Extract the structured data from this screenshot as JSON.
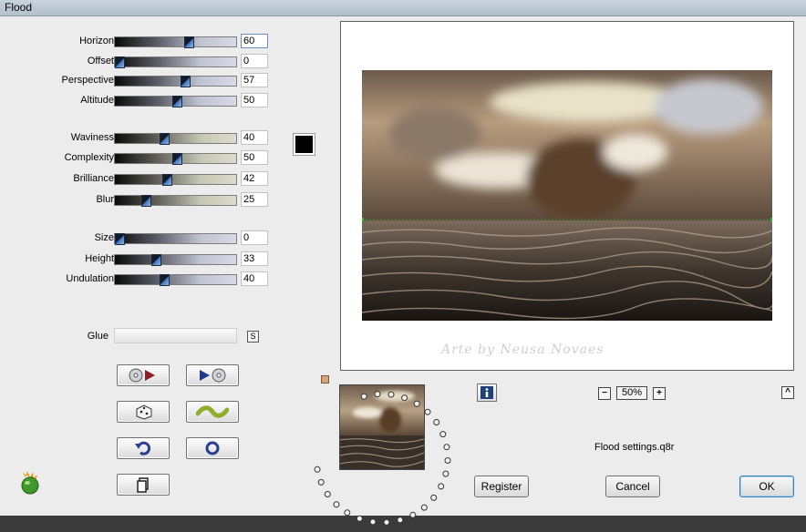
{
  "window": {
    "title": "Flood"
  },
  "sliders": [
    {
      "label": "Horizon",
      "value": "60",
      "fraction": 0.6,
      "track": "blue",
      "focused": true
    },
    {
      "label": "Offset",
      "value": "0",
      "fraction": 0.03,
      "track": "blue"
    },
    {
      "label": "Perspective",
      "value": "57",
      "fraction": 0.57,
      "track": "blue"
    },
    {
      "label": "Altitude",
      "value": "50",
      "fraction": 0.5,
      "track": "blue"
    },
    {
      "label": "Waviness",
      "value": "40",
      "fraction": 0.4,
      "track": "sand"
    },
    {
      "label": "Complexity",
      "value": "50",
      "fraction": 0.5,
      "track": "sand"
    },
    {
      "label": "Brilliance",
      "value": "42",
      "fraction": 0.42,
      "track": "sand"
    },
    {
      "label": "Blur",
      "value": "25",
      "fraction": 0.25,
      "track": "sand"
    },
    {
      "label": "Size",
      "value": "0",
      "fraction": 0.03,
      "track": "blue"
    },
    {
      "label": "Height",
      "value": "33",
      "fraction": 0.33,
      "track": "blue"
    },
    {
      "label": "Undulation",
      "value": "40",
      "fraction": 0.4,
      "track": "blue"
    }
  ],
  "glue": {
    "label": "Glue",
    "mode": "S"
  },
  "color": {
    "swatch": "#000000",
    "accent_blue": "#3f73b8",
    "ok_border": "#3c7fb1",
    "horizon_marker": "#21c621"
  },
  "preview": {
    "watermark": "Arte by Neusa Novaes"
  },
  "zoom": {
    "value": "50%",
    "minus": "−",
    "plus": "+"
  },
  "settings_file": "Flood settings.q8r",
  "buttons": {
    "register": "Register",
    "cancel": "Cancel",
    "ok": "OK",
    "glue_s": "S",
    "collapse": "^"
  },
  "icons": {
    "next_preset": "disc-play-icon",
    "prev_preset": "play-disc-icon",
    "random": "dice-icon",
    "wave": "wave-icon",
    "reset": "undo-arrow-icon",
    "default": "ring-icon",
    "copy": "clipboard-icon",
    "info": "info-icon",
    "logo": "flaming-logo-icon"
  }
}
